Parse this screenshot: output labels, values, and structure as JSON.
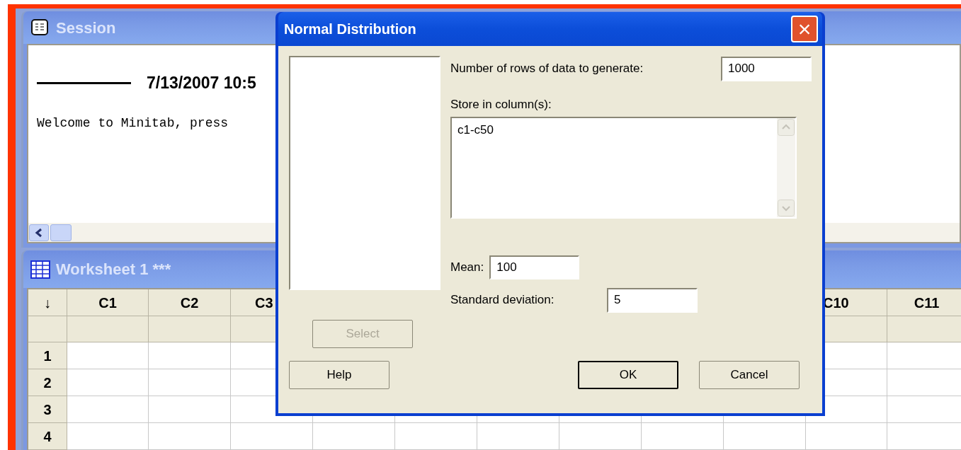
{
  "session": {
    "title": "Session",
    "date_line": "7/13/2007 10:5",
    "welcome": "Welcome to Minitab, press"
  },
  "worksheet": {
    "title": "Worksheet 1 ***",
    "corner": "↓",
    "columns_left": [
      "C1",
      "C2",
      "C3"
    ],
    "columns_right": [
      "C10",
      "C11"
    ],
    "rows": [
      "1",
      "2",
      "3",
      "4"
    ]
  },
  "dialog": {
    "title": "Normal Distribution",
    "close": "×",
    "rows_label": "Number of rows of data to generate:",
    "rows_value": "1000",
    "store_label": "Store in column(s):",
    "store_value": "c1-c50",
    "mean_label": "Mean:",
    "mean_value": "100",
    "sd_label": "Standard deviation:",
    "sd_value": "5",
    "select_button": {
      "label": "Select",
      "disabled": true
    },
    "buttons": [
      {
        "label": "Help",
        "default": false
      },
      {
        "label": "OK",
        "default": true
      },
      {
        "label": "Cancel",
        "default": false
      }
    ]
  }
}
